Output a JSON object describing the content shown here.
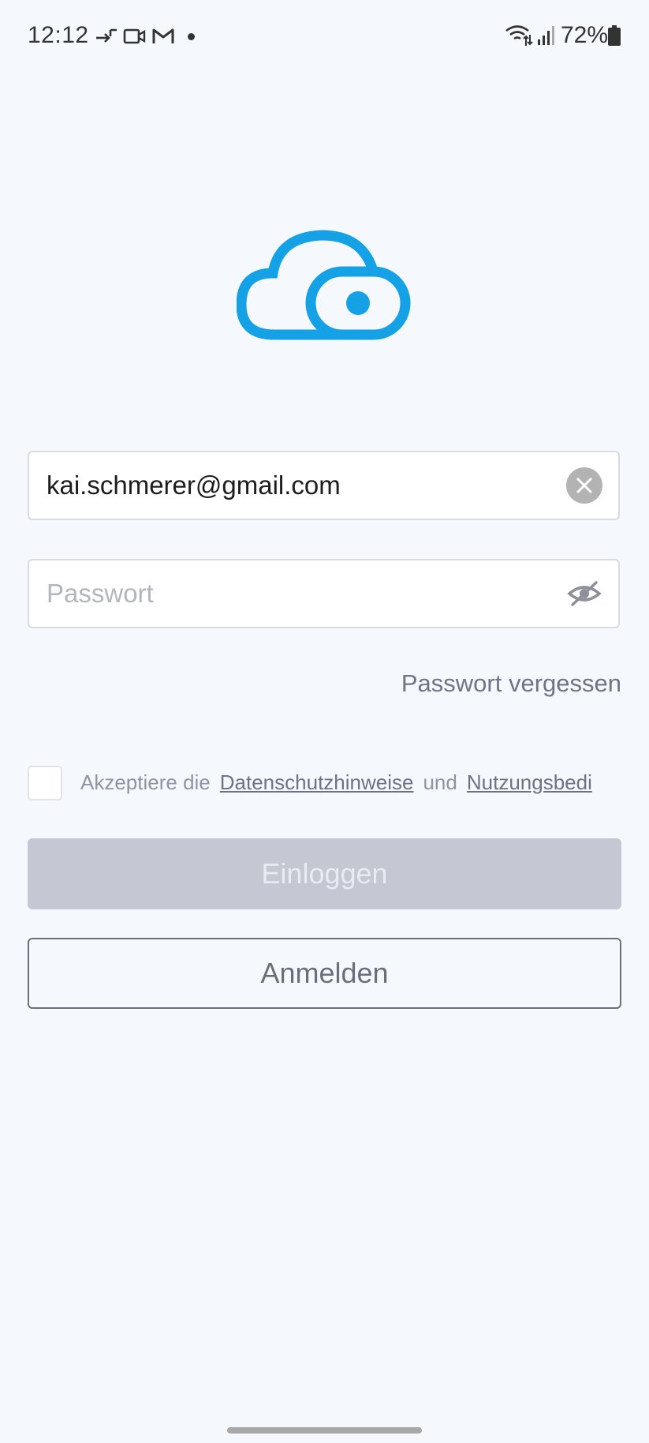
{
  "status_bar": {
    "time": "12:12",
    "battery": "72%",
    "icons": [
      "call-forward-icon",
      "video-icon",
      "gmail-icon",
      "notification-dot-icon",
      "wifi-icon",
      "signal-icon",
      "battery-icon"
    ]
  },
  "logo": {
    "icon": "cloud-eye-logo-icon",
    "color": "#14a1e6"
  },
  "login": {
    "email_value": "kai.schmerer@gmail.com",
    "password_placeholder": "Passwort",
    "forgot_password": "Passwort vergessen",
    "terms_prefix": "Akzeptiere die",
    "terms_privacy": "Datenschutzhinweise",
    "terms_and": "und",
    "terms_usage": "Nutzungsbedi",
    "login_button": "Einloggen",
    "register_button": "Anmelden"
  },
  "colors": {
    "background": "#f5f8fd",
    "accent": "#14a1e6",
    "disabled_button": "#c5c8d3",
    "outline_button": "#6b6f7a"
  }
}
